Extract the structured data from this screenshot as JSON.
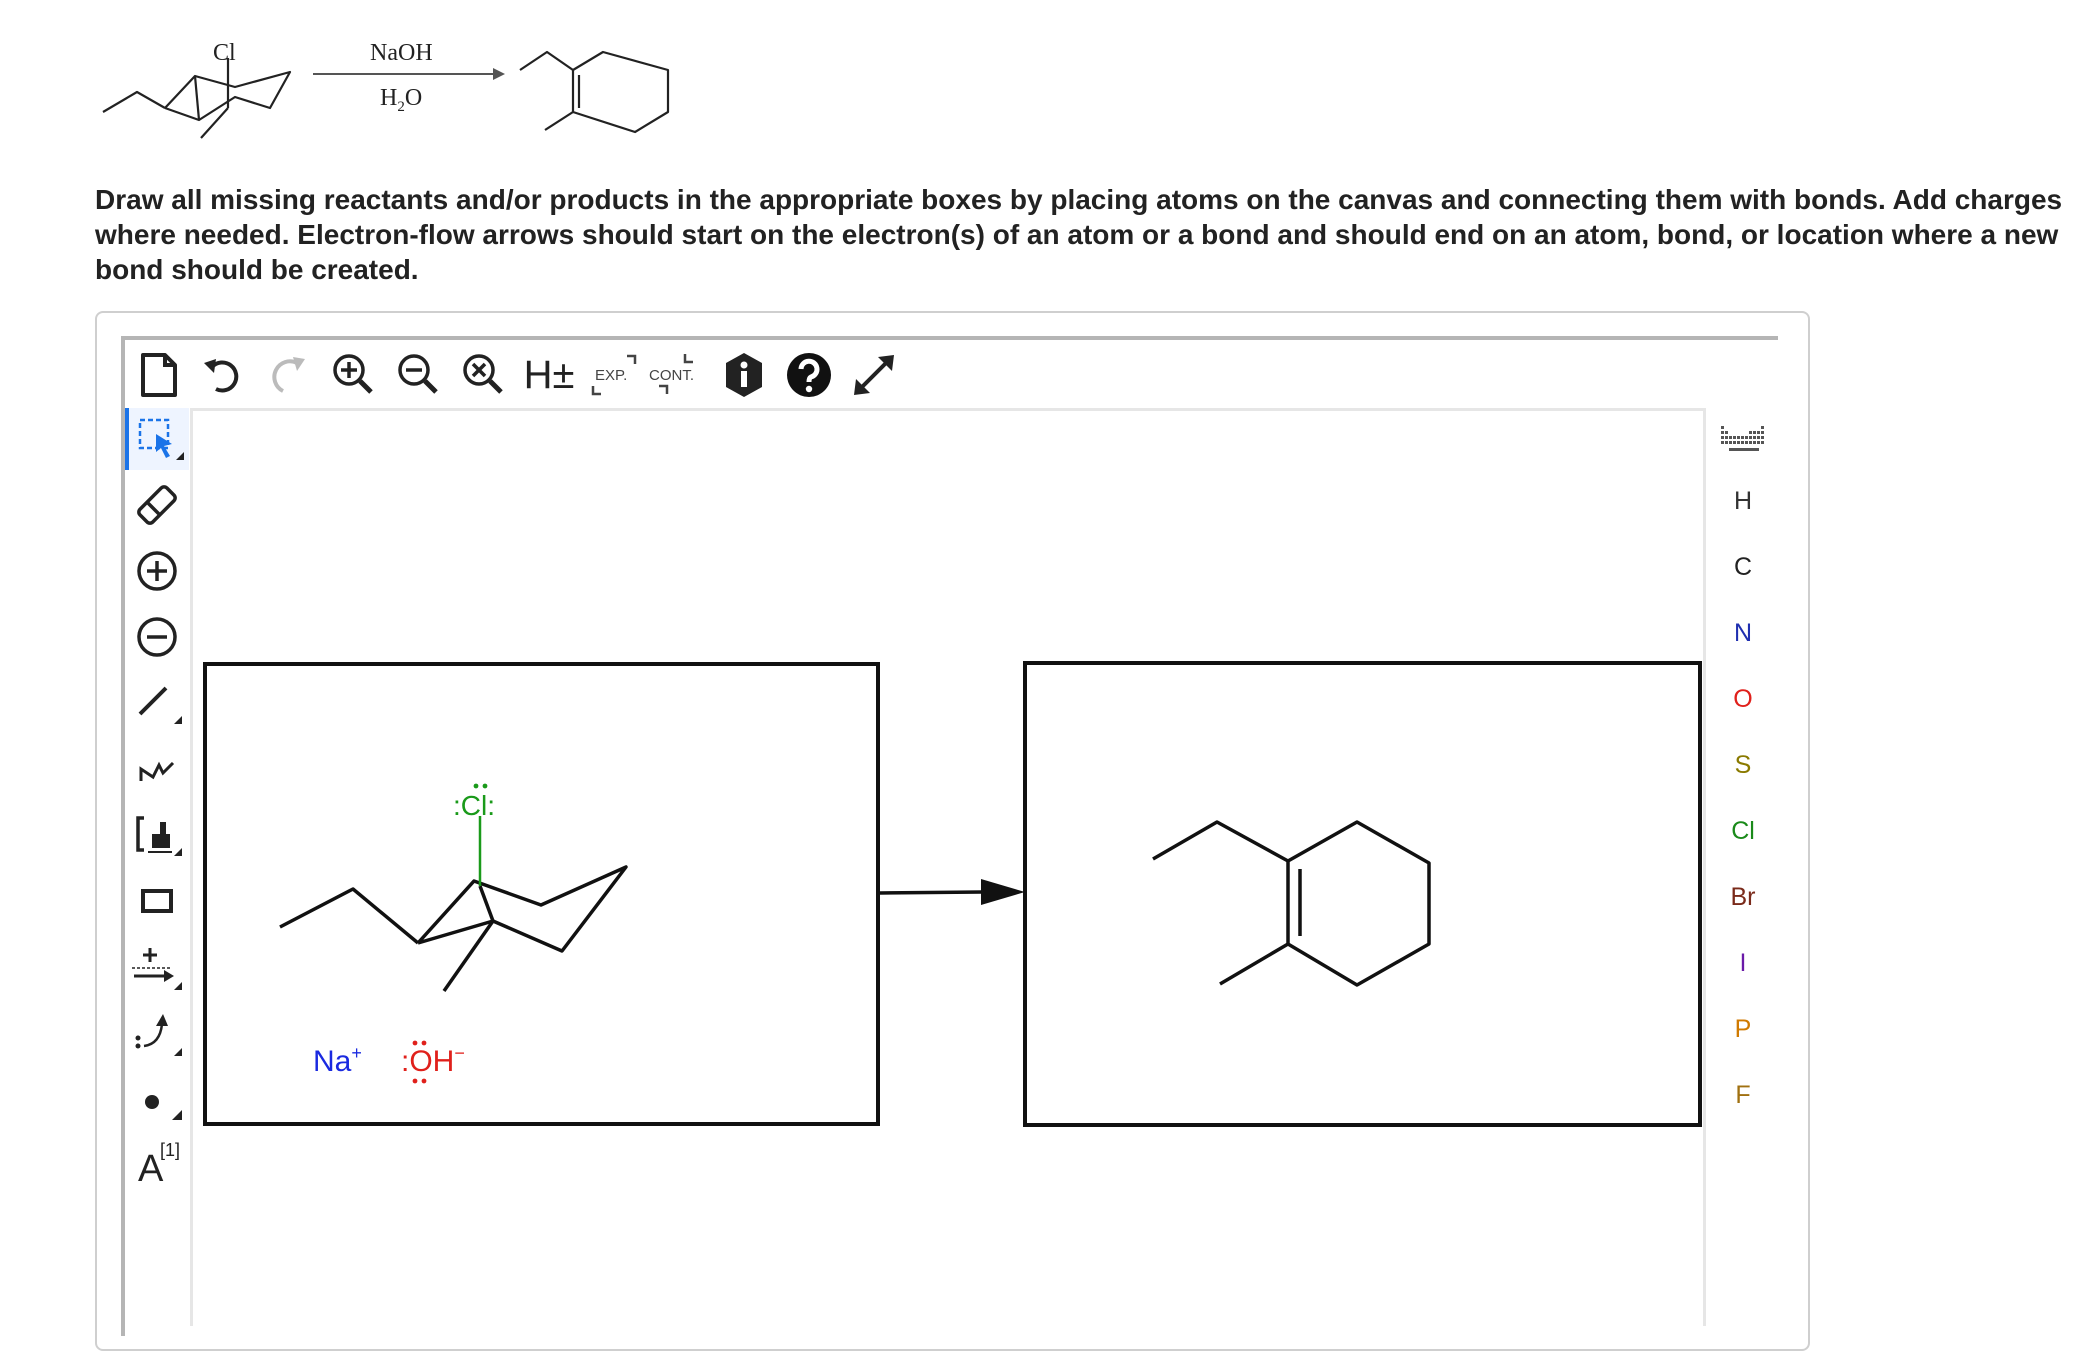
{
  "reaction": {
    "reagent_top": "NaOH",
    "reagent_bottom": "H2O",
    "reactant_substituent": "Cl"
  },
  "instructions": {
    "line1": "Draw all missing reactants and/or products in the appropriate boxes by placing atoms on the canvas and connecting them with bonds. Add charges",
    "line2": "where needed. Electron-flow arrows should start on the electron(s) of an atom or a bond and should end on an atom, bond, or location where a new",
    "line3": "bond should be created."
  },
  "toolbar": {
    "h_toggle": "H±",
    "expand_label": "EXP.",
    "contract_label": "CONT."
  },
  "left_toolbar": {
    "atom_map_label": "A",
    "atom_map_index": "[1]"
  },
  "canvas": {
    "reactant_atom": ":Cl:",
    "cation": "Na",
    "cation_charge": "+",
    "anion": ":OH",
    "anion_charge": "−"
  },
  "atoms": [
    {
      "symbol": "H",
      "color": "#333333"
    },
    {
      "symbol": "C",
      "color": "#222222"
    },
    {
      "symbol": "N",
      "color": "#1f2fb0"
    },
    {
      "symbol": "O",
      "color": "#e0201b"
    },
    {
      "symbol": "S",
      "color": "#8a7a00"
    },
    {
      "symbol": "Cl",
      "color": "#1a8a1a"
    },
    {
      "symbol": "Br",
      "color": "#7a2a1a"
    },
    {
      "symbol": "I",
      "color": "#6a1aa8"
    },
    {
      "symbol": "P",
      "color": "#d07a00"
    },
    {
      "symbol": "F",
      "color": "#a07010"
    }
  ],
  "colors": {
    "accent": "#1a73e8",
    "chlorine": "#1a9a1a",
    "sodium": "#1a2ae0",
    "oxygen": "#e0201b"
  }
}
